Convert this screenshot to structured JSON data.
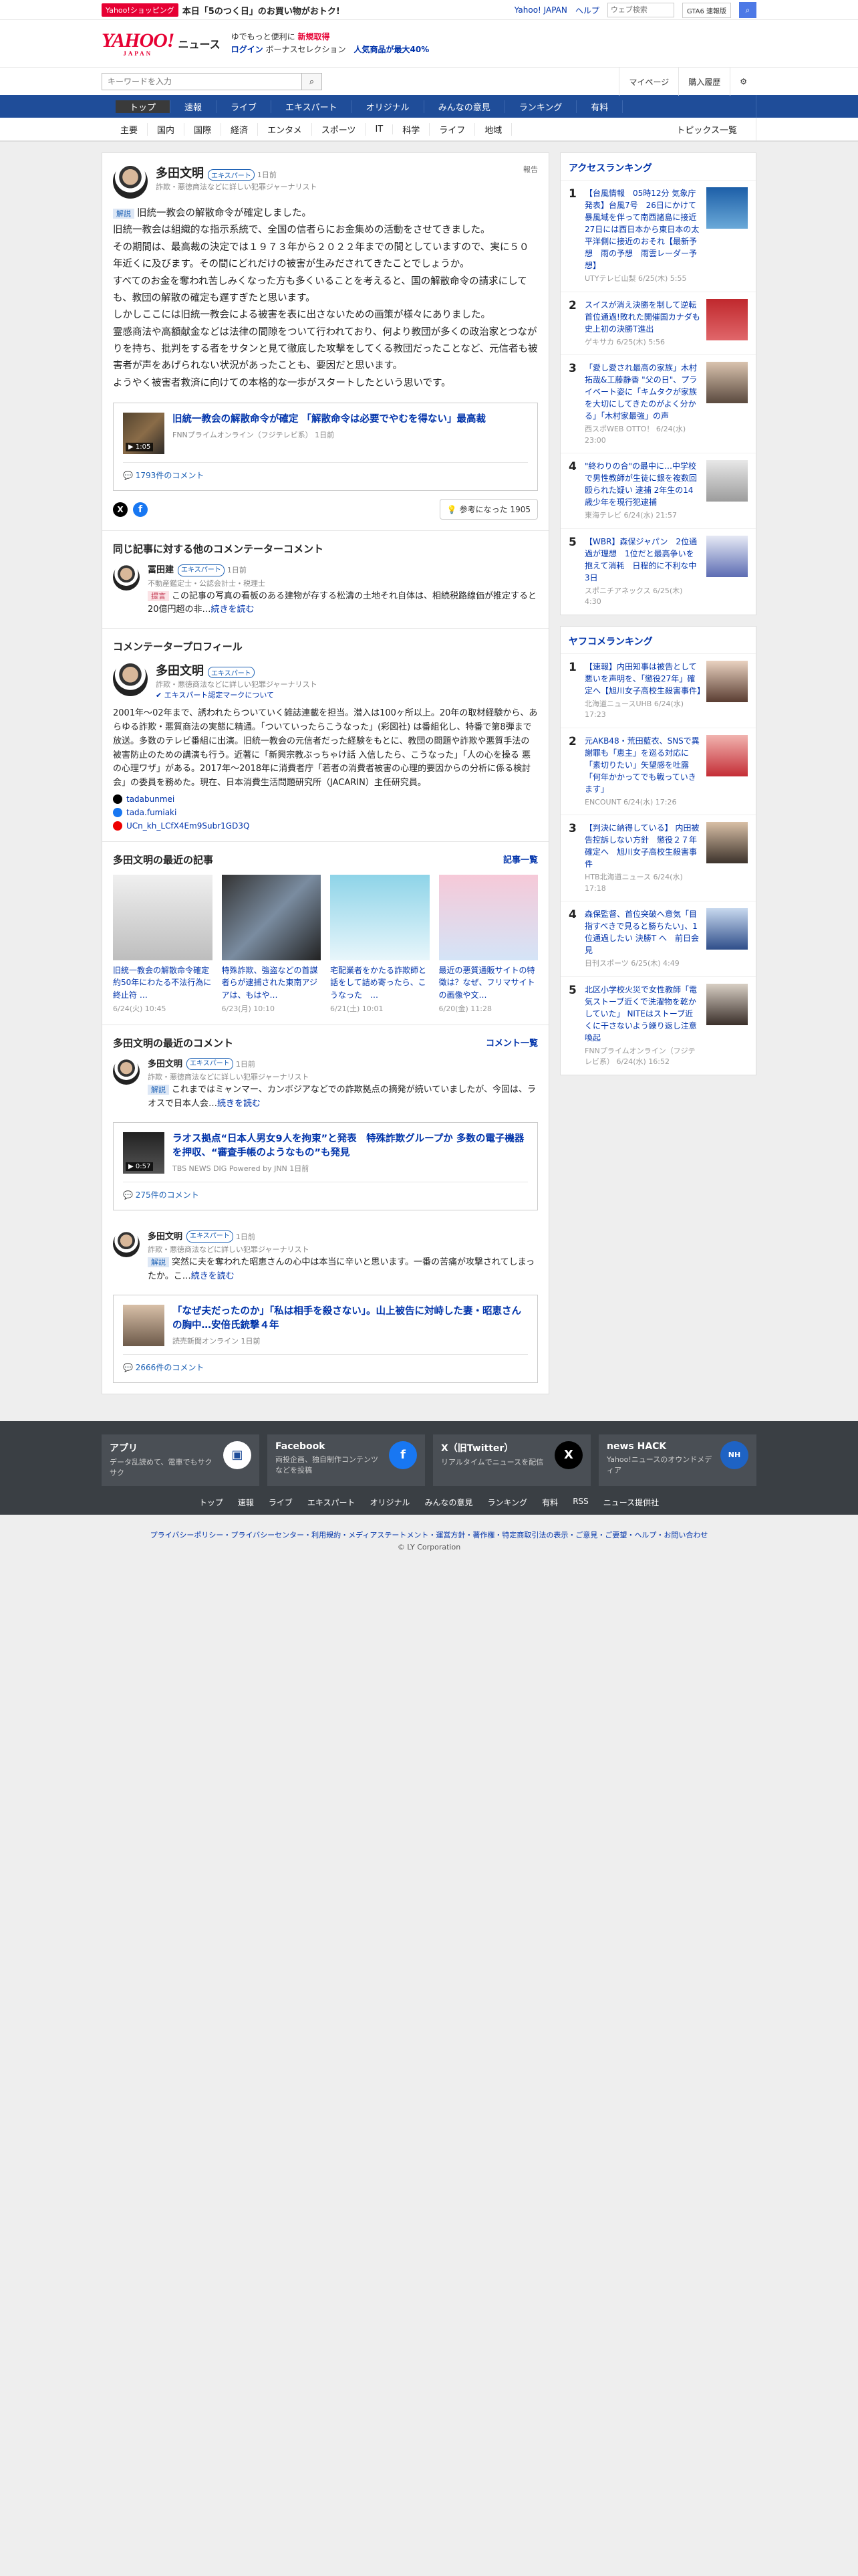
{
  "top": {
    "shop_tag": "Yahoo!ショッピング",
    "promo": "本日「5のつく日」のお買い物がおトク!",
    "links": [
      "Yahoo! JAPAN",
      "ヘルプ"
    ],
    "search_placeholder": "ウェブ検索",
    "gta": "GTA6 速報版"
  },
  "header": {
    "logo": "YAHOO!",
    "logo_sub": "JAPAN",
    "news": "ニュース",
    "line1": "ゆでもっと便利に",
    "line1_bold": "新規取得",
    "login": "ログイン",
    "bonus": "ボーナスセレクション",
    "sale": "人気商品が最大40%"
  },
  "search": {
    "placeholder": "キーワードを入力",
    "mypage": "マイページ",
    "history": "購入履歴"
  },
  "nav": [
    "トップ",
    "速報",
    "ライブ",
    "エキスパート",
    "オリジナル",
    "みんなの意見",
    "ランキング",
    "有料"
  ],
  "subnav": [
    "主要",
    "国内",
    "国際",
    "経済",
    "エンタメ",
    "スポーツ",
    "IT",
    "科学",
    "ライフ",
    "地域"
  ],
  "subnav_last": "トピックス一覧",
  "comment": {
    "author": "多田文明",
    "badge": "エキスパート",
    "time": "1日前",
    "role": "詐欺・悪徳商法などに詳しい犯罪ジャーナリスト",
    "report": "報告",
    "tag": "解説",
    "lines": [
      "旧統一教会の解散命令が確定しました。",
      "旧統一教会は組織的な指示系統で、全国の信者らにお金集めの活動をさせてきました。",
      "その期間は、最高裁の決定では１９７３年から２０２２年までの間としていますので、実に５０年近くに及びます。その間にどれだけの被害が生みだされてきたことでしょうか。",
      "すべてのお金を奪われ苦しみくなった方も多くいることを考えると、国の解散命令の請求にしても、教団の解散の確定も遅すぎたと思います。",
      "しかしここには旧統一教会による被害を表に出さないための画策が様々にありました。",
      "霊感商法や高額献金などは法律の間隙をついて行われており、何より教団が多くの政治家とつながりを持ち、批判をする者をサタンと見て徹底した攻撃をしてくる教団だったことなど、元信者も被害者が声をあげられない状況があったことも、要因だと思います。",
      "ようやく被害者救済に向けての本格的な一歩がスタートしたという思いです。"
    ],
    "news_title": "旧統一教会の解散命令が確定 「解散命令は必要でやむを得ない」最高裁",
    "news_src": "FNNプライムオンライン（フジテレビ系）",
    "news_time": "1日前",
    "duration": "1:05",
    "comments": "1793件のコメント",
    "helpful": "参考になった 1905"
  },
  "others": {
    "heading": "同じ記事に対する他のコメンテーターコメント",
    "author": "冨田建",
    "badge": "エキスパート",
    "time": "1日前",
    "role": "不動産鑑定士・公認会計士・税理士",
    "tag": "提言",
    "text": "この記事の写真の看板のある建物が存する松濤の土地それ自体は、相続税路線価が推定すると20億円超の非…",
    "more": "続きを読む"
  },
  "profile": {
    "heading": "コメンテータープロフィール",
    "author": "多田文明",
    "badge": "エキスパート",
    "role": "詐欺・悪徳商法などに詳しい犯罪ジャーナリスト",
    "link": "エキスパート認定マークについて",
    "text": "2001年〜02年まで、誘われたらついていく雑誌連載を担当。潜入は100ヶ所以上。20年の取材経験から、あらゆる詐欺・悪質商法の実態に精通。「ついていったらこうなった」(彩図社) は番組化し、特番で第8弾まで放送。多数のテレビ番組に出演。旧統一教会の元信者だった経験をもとに、教団の問題や詐欺や悪質手法の被害防止のための講演も行う。近著に「新興宗教ぶっちゃけ話 入信したら、こうなった」「人の心を操る 悪の心理ワザ」がある。2017年〜2018年に消費者庁「若者の消費者被害の心理的要因からの分析に係る検討会」の委員を務めた。現在、日本消費生活問題研究所（JACARIN）主任研究員。",
    "sns": [
      "tadabunmei",
      "tada.fumiaki",
      "UCn_kh_LCfX4Em9Subr1GD3Q"
    ]
  },
  "recent": {
    "heading": "多田文明の最近の記事",
    "more": "記事一覧",
    "items": [
      {
        "title": "旧統一教会の解散命令確定 約50年にわたる不法行為に終止符 …",
        "date": "6/24(火) 10:45"
      },
      {
        "title": "特殊詐欺、強盗などの首謀者らが逮捕された東南アジアは、もはや…",
        "date": "6/23(月) 10:10"
      },
      {
        "title": "宅配業者をかたる詐欺師と話をして詰め寄ったら、こうなった　…",
        "date": "6/21(土) 10:01"
      },
      {
        "title": "最近の悪質通販サイトの特徴は？なぜ、フリマサイトの画像や文…",
        "date": "6/20(金) 11:28"
      }
    ]
  },
  "recent_comments": {
    "heading": "多田文明の最近のコメント",
    "more": "コメント一覧",
    "items": [
      {
        "author": "多田文明",
        "badge": "エキスパート",
        "time": "1日前",
        "role": "詐欺・悪徳商法などに詳しい犯罪ジャーナリスト",
        "tag": "解説",
        "text": "これまではミャンマー、カンボジアなどでの詐欺拠点の摘発が続いていましたが、今回は、ラオスで日本人会…",
        "more": "続きを読む",
        "news": "ラオス拠点“日本人男女9人を拘束”と発表　特殊詐欺グループか 多数の電子機器を押収、“審査手帳のようなもの”も発見",
        "src": "TBS NEWS DIG Powered by JNN 1日前",
        "duration": "0:57",
        "comments": "275件のコメント"
      },
      {
        "author": "多田文明",
        "badge": "エキスパート",
        "time": "1日前",
        "role": "詐欺・悪徳商法などに詳しい犯罪ジャーナリスト",
        "tag": "解説",
        "text": "突然に夫を奪われた昭恵さんの心中は本当に辛いと思います。一番の苦痛が攻撃されてしまったか。こ…",
        "more": "続きを読む",
        "news": "「なぜ夫だったのか」「私は相手を殺さない」。山上被告に対峙した妻・昭恵さんの胸中…安倍氏銃撃４年",
        "src": "読売新聞オンライン 1日前",
        "duration": "",
        "comments": "2666件のコメント"
      }
    ]
  },
  "access": {
    "heading": "アクセスランキング",
    "items": [
      {
        "title": "【台風情報　05時12分 気象庁発表】台風7号　26日にかけて暴風域を伴って南西諸島に接近　27日には西日本から東日本の太平洋側に接近のおそれ【最新予想　雨の予想　雨雲レーダー予想】",
        "src": "UTYテレビ山梨 6/25(木) 5:55"
      },
      {
        "title": "スイスが消え決勝を制して逆転首位通過!敗れた開催国カナダも史上初の決勝T進出",
        "src": "ゲキサカ 6/25(木) 5:56"
      },
      {
        "title": "「愛し愛され最高の家族」木村拓哉&工藤静香 \"父の日\"、プライベート姿に「キムタクが家族を大切にしてきたのがよく分かる」「木村家最強」の声",
        "src": "西スポWEB OTTO！ 6/24(水) 23:00"
      },
      {
        "title": "\"終わりの合\"の最中に…中学校で男性教師が生徒に銀を複数回殴られた疑い 逮捕 2年生の14歳少年を現行犯逮捕",
        "src": "東海テレビ 6/24(水) 21:57"
      },
      {
        "title": "【WBR】森保ジャパン　2位通過が理想　1位だと最高争いを抱えて消耗　日程的に不利な中3日",
        "src": "スポニチアネックス 6/25(木) 4:30"
      }
    ]
  },
  "yahoo_rank": {
    "heading": "ヤフコメランキング",
    "items": [
      {
        "title": "【速報】内田知事は被告として悪いを声明を、「懲役27年」確定へ【旭川女子高校生殺害事件】",
        "src": "北海道ニュースUHB 6/24(水) 17:23"
      },
      {
        "title": "元AKB48・荒田藍衣、SNSで異謝罪も「恵主」を巡る対応に「素切りたい」矢望感を吐露「何年かかってでも戦っていきます」",
        "src": "ENCOUNT 6/24(水) 17:26"
      },
      {
        "title": "【判決に納得している】 内田被告控訴しない方針　懲役２７年確定へ　旭川女子高校生殺害事件",
        "src": "HTB北海道ニュース 6/24(水) 17:18"
      },
      {
        "title": "森保監督、首位突破へ意気「目指すべきで見ると勝ちたい」、1位通過したい 決勝T へ　前日会見",
        "src": "日刊スポーツ 6/25(木) 4:49"
      },
      {
        "title": "北区小学校火災で女性教師「電気ストーブ近くで洗濯物を乾かしていた」 NITEはストーブ近くに干さないよう繰り返し注意喚起",
        "src": "FNNプライムオンライン（フジテレビ系） 6/24(水) 16:52"
      }
    ]
  },
  "footer": {
    "apps": [
      {
        "t": "アプリ",
        "d": "データ乱読めて、電車でもサクサク"
      },
      {
        "t": "Facebook",
        "d": "両投企画、独自制作コンテンツなどを投稿"
      },
      {
        "t": "X（旧Twitter）",
        "d": "リアルタイムでニュースを配信"
      },
      {
        "t": "news HACK",
        "d": "Yahoo!ニュースのオウンドメディア"
      }
    ],
    "nav": [
      "トップ",
      "速報",
      "ライブ",
      "エキスパート",
      "オリジナル",
      "みんなの意見",
      "ランキング",
      "有料",
      "RSS",
      "ニュース提供社"
    ],
    "legal1": "プライバシーポリシー・プライバシーセンター・利用規約・メディアステートメント・運営方針・著作権・特定商取引法の表示・ご意見・ご要望・ヘルプ・お問い合わせ",
    "copyright": "© LY Corporation"
  },
  "colors": {
    "brand": "#e60033",
    "nav": "#1f4d99",
    "link": "#0033aa"
  }
}
